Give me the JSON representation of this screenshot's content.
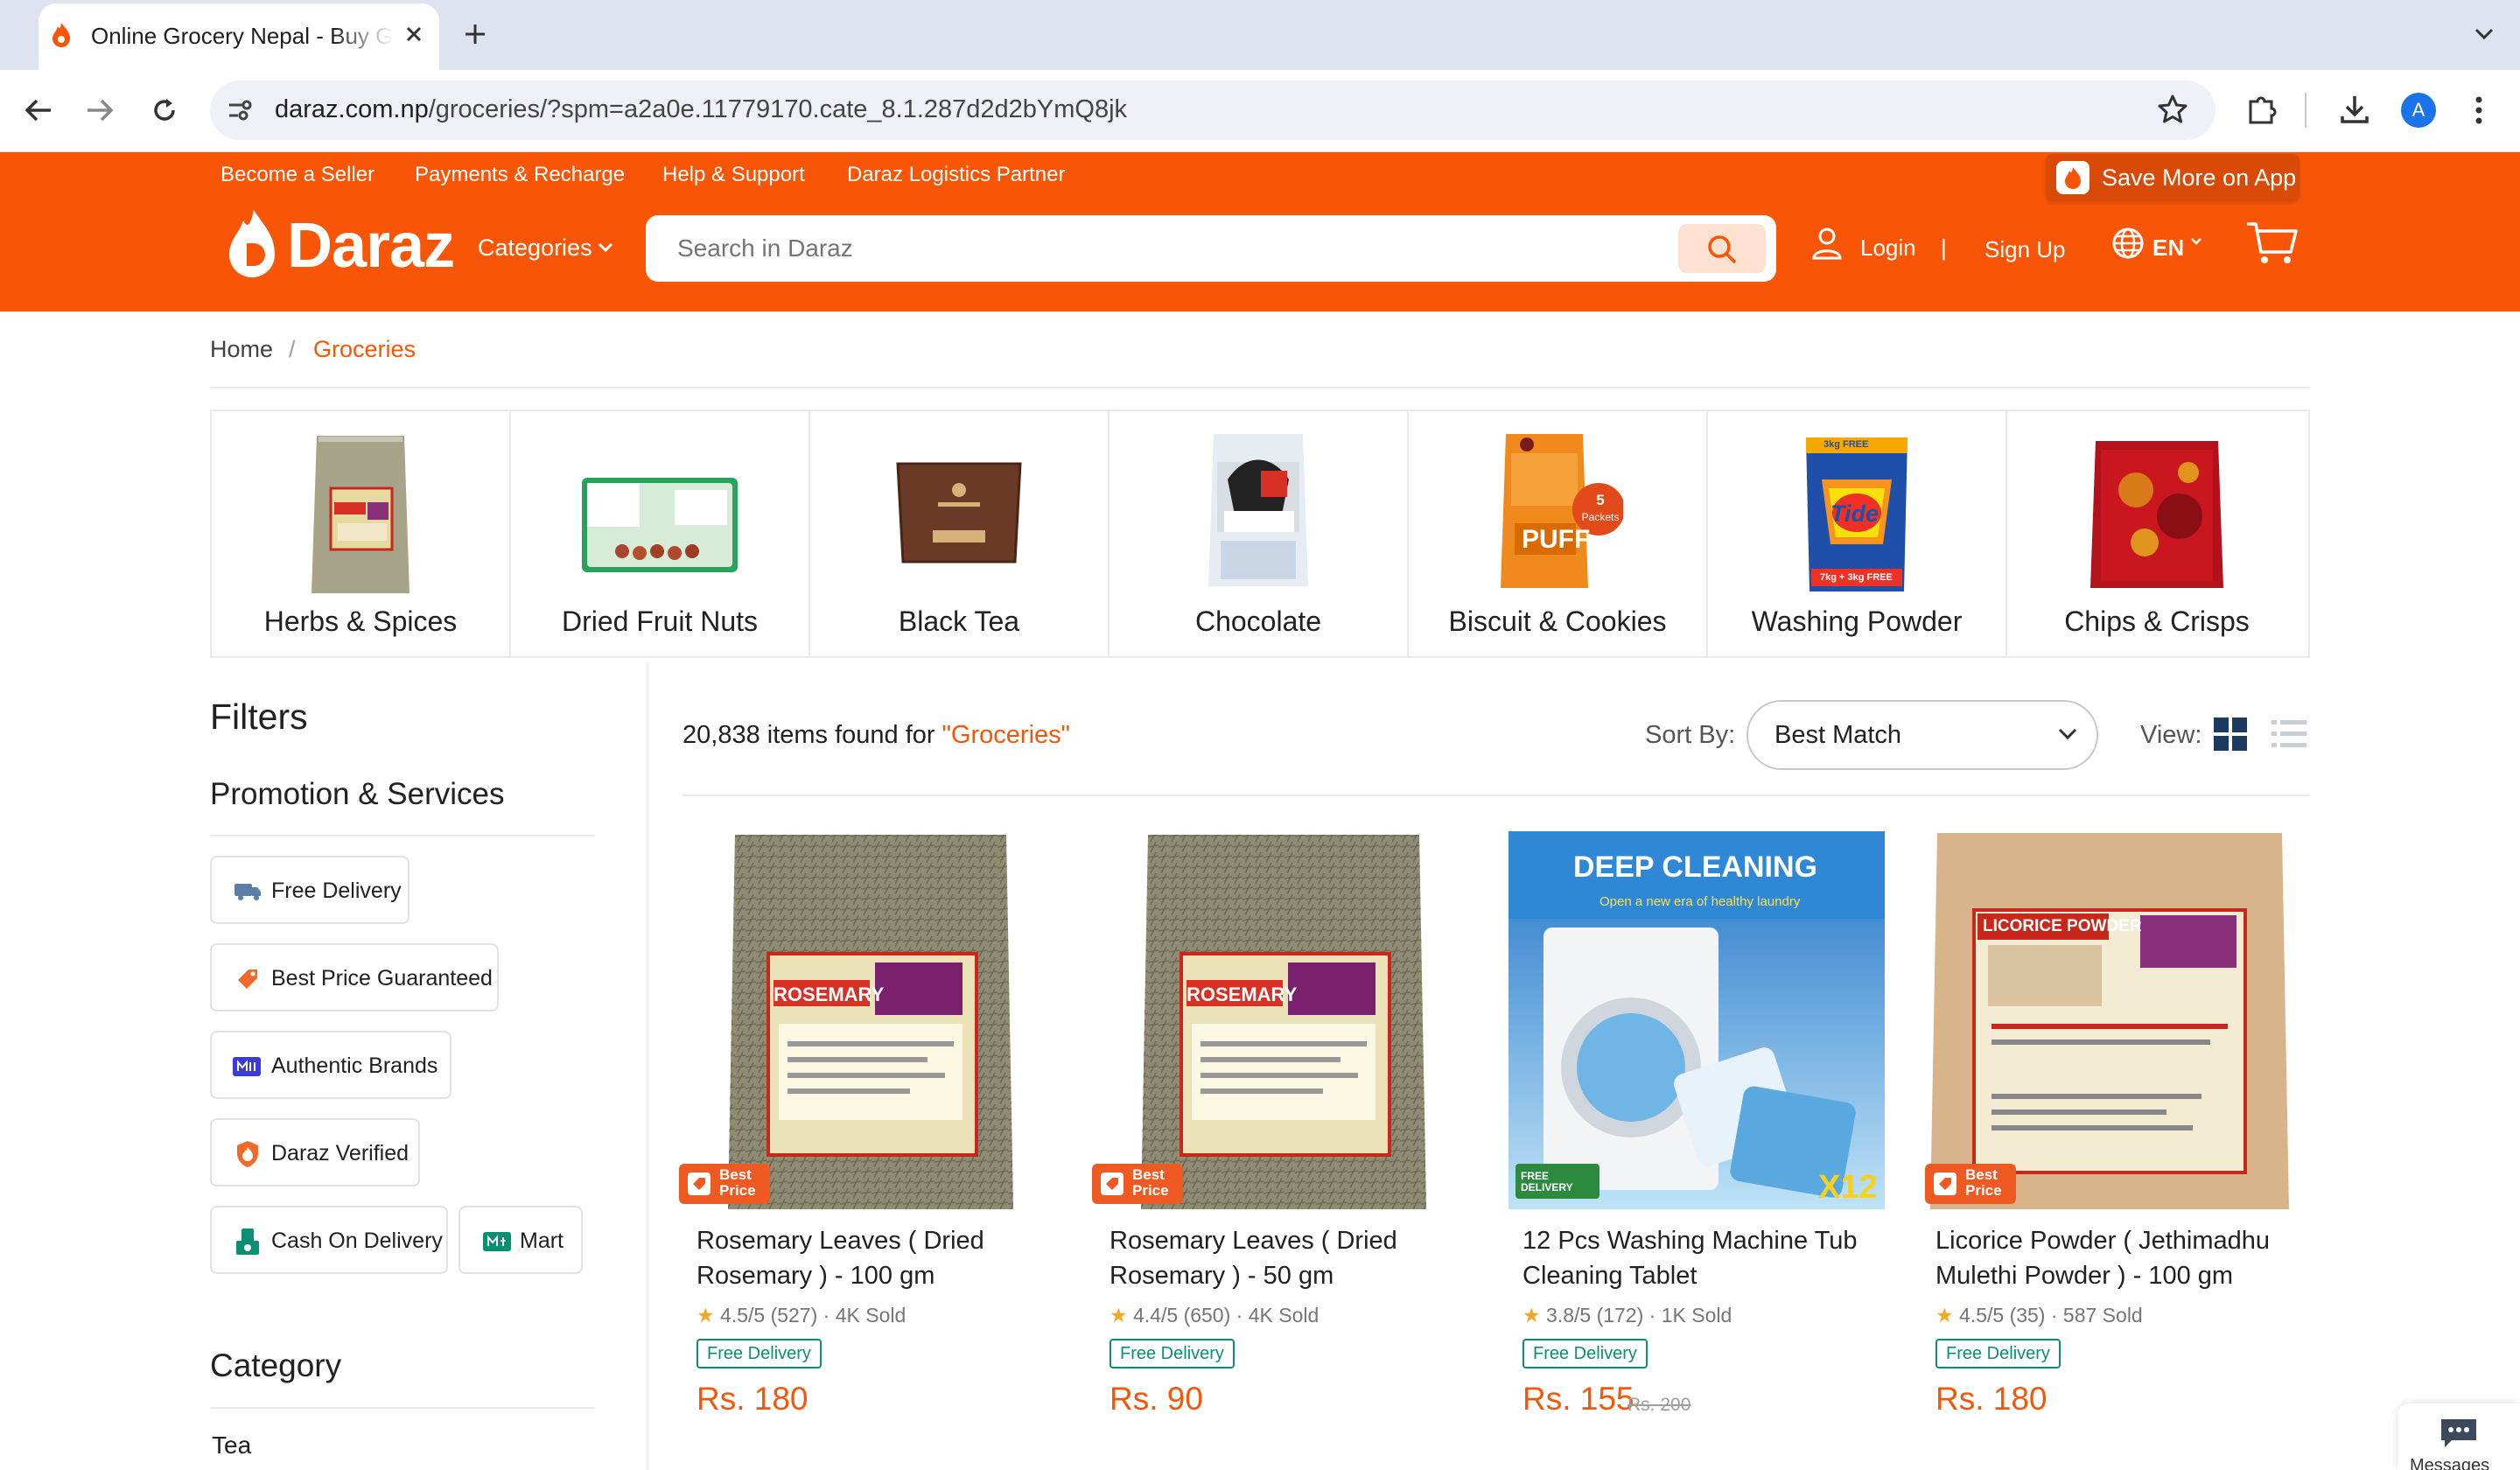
{
  "browser": {
    "tab_title": "Online Grocery Nepal - Buy Groceries Online",
    "url_domain": "daraz.com.np",
    "url_path": "/groceries/?spm=a2a0e.11779170.cate_8.1.287d2d2bYmQ8jk",
    "profile_initial": "A"
  },
  "topbar": {
    "links": [
      "Become a Seller",
      "Payments & Recharge",
      "Help & Support",
      "Daraz Logistics Partner"
    ],
    "save_app": "Save More on App"
  },
  "header": {
    "logo": "Daraz",
    "categories": "Categories",
    "search_placeholder": "Search in Daraz",
    "login": "Login",
    "separator": "|",
    "signup": "Sign Up",
    "language": "EN"
  },
  "breadcrumb": {
    "home": "Home",
    "separator": "/",
    "current": "Groceries"
  },
  "category_strip": [
    {
      "label": "Herbs & Spices"
    },
    {
      "label": "Dried Fruit Nuts"
    },
    {
      "label": "Black Tea"
    },
    {
      "label": "Chocolate"
    },
    {
      "label": "Biscuit & Cookies",
      "badge_num": "5",
      "badge_text": "Packets",
      "pack_text": "PUFF"
    },
    {
      "label": "Washing Powder",
      "brand": "Tide",
      "promo": "3kg FREE",
      "promo2": "7kg + 3kg FREE"
    },
    {
      "label": "Chips & Crisps"
    }
  ],
  "filters": {
    "title": "Filters",
    "promo_title": "Promotion & Services",
    "chips": [
      "Free Delivery",
      "Best Price Guaranteed",
      "Authentic Brands",
      "Daraz Verified",
      "Cash On Delivery",
      "Mart"
    ],
    "category_title": "Category",
    "category_first": "Tea"
  },
  "results": {
    "count_text": "20,838 items found for ",
    "query": "\"Groceries\"",
    "sort_label": "Sort By:",
    "sort_value": "Best Match",
    "view_label": "View:"
  },
  "products": [
    {
      "title": "Rosemary Leaves ( Dried Rosemary ) - 100 gm",
      "rating": "4.5/5",
      "reviews": "(527)",
      "sold": "4K Sold",
      "tag": "Free Delivery",
      "price": "Rs. 180",
      "old_price": "",
      "badge": "Best Price",
      "pack_label": "ROSEMARY"
    },
    {
      "title": "Rosemary Leaves ( Dried Rosemary ) - 50 gm",
      "rating": "4.4/5",
      "reviews": "(650)",
      "sold": "4K Sold",
      "tag": "Free Delivery",
      "price": "Rs. 90",
      "old_price": "",
      "badge": "Best Price",
      "pack_label": "ROSEMARY"
    },
    {
      "title": "12 Pcs Washing Machine Tub Cleaning Tablet",
      "rating": "3.8/5",
      "reviews": "(172)",
      "sold": "1K Sold",
      "tag": "Free Delivery",
      "price": "Rs. 155",
      "old_price": "Rs. 200",
      "badge": "FREE DELIVERY",
      "banner": "DEEP CLEANING",
      "subbanner": "Open a new era of healthy laundry",
      "qty": "X12"
    },
    {
      "title": "Licorice Powder ( Jethimadhu Mulethi Powder ) - 100 gm",
      "rating": "4.5/5",
      "reviews": "(35)",
      "sold": "587 Sold",
      "tag": "Free Delivery",
      "price": "Rs. 180",
      "old_price": "",
      "badge": "Best Price",
      "pack_label": "LICORICE POWDER"
    }
  ],
  "colors": {
    "brand": "#f85606",
    "free_tag": "#0a8f72",
    "star": "#f5a623"
  },
  "misc": {
    "messages": "Messages"
  }
}
